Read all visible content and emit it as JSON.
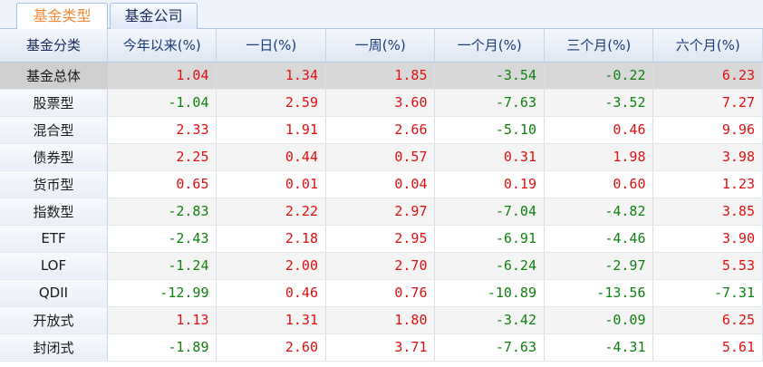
{
  "tabs": [
    {
      "label": "基金类型",
      "active": true
    },
    {
      "label": "基金公司",
      "active": false
    }
  ],
  "table": {
    "headers": [
      "基金分类",
      "今年以来(%)",
      "一日(%)",
      "一周(%)",
      "一个月(%)",
      "三个月(%)",
      "六个月(%)"
    ],
    "rows": [
      {
        "name": "基金总体",
        "values": [
          "1.04",
          "1.34",
          "1.85",
          "-3.54",
          "-0.22",
          "6.23"
        ]
      },
      {
        "name": "股票型",
        "values": [
          "-1.04",
          "2.59",
          "3.60",
          "-7.63",
          "-3.52",
          "7.27"
        ]
      },
      {
        "name": "混合型",
        "values": [
          "2.33",
          "1.91",
          "2.66",
          "-5.10",
          "0.46",
          "9.96"
        ]
      },
      {
        "name": "债券型",
        "values": [
          "2.25",
          "0.44",
          "0.57",
          "0.31",
          "1.98",
          "3.98"
        ]
      },
      {
        "name": "货币型",
        "values": [
          "0.65",
          "0.01",
          "0.04",
          "0.19",
          "0.60",
          "1.23"
        ]
      },
      {
        "name": "指数型",
        "values": [
          "-2.83",
          "2.22",
          "2.97",
          "-7.04",
          "-4.82",
          "3.85"
        ]
      },
      {
        "name": "ETF",
        "values": [
          "-2.43",
          "2.18",
          "2.95",
          "-6.91",
          "-4.46",
          "3.90"
        ]
      },
      {
        "name": "LOF",
        "values": [
          "-1.24",
          "2.00",
          "2.70",
          "-6.24",
          "-2.97",
          "5.53"
        ]
      },
      {
        "name": "QDII",
        "values": [
          "-12.99",
          "0.46",
          "0.76",
          "-10.89",
          "-13.56",
          "-7.31"
        ]
      },
      {
        "name": "开放式",
        "values": [
          "1.13",
          "1.31",
          "1.80",
          "-3.42",
          "-0.09",
          "6.25"
        ]
      },
      {
        "name": "封闭式",
        "values": [
          "-1.89",
          "2.60",
          "3.71",
          "-7.63",
          "-4.31",
          "5.61"
        ]
      }
    ],
    "selected_row": 0
  },
  "colors": {
    "positive": "#e01010",
    "negative": "#108010",
    "active_tab": "#f08a3a"
  }
}
